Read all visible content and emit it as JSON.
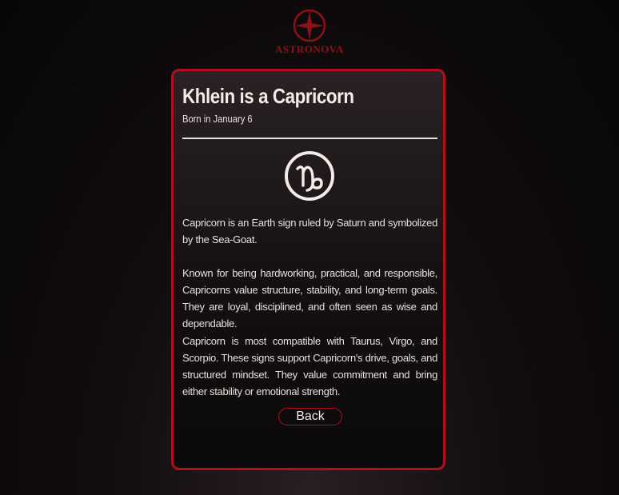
{
  "brand": {
    "name": "ASTRONOVA",
    "logo_icon": "compass-star-icon",
    "color": "#8e1018"
  },
  "card": {
    "title": "Khlein is a Capricorn",
    "subtitle": "Born in January 6",
    "symbol_icon": "capricorn-icon",
    "paragraphs": [
      "Capricorn is an Earth sign ruled by Saturn and symbolized by the Sea-Goat.",
      "Known for being hardworking, practical, and responsible, Capricorns value structure, stability, and long-term goals. They are loyal, disciplined, and often seen as wise and dependable.",
      "Capricorn is most compatible with Taurus, Virgo, and Scorpio. These signs support Capricorn's drive, goals, and structured mindset. They value commitment and bring either stability or emotional strength."
    ],
    "back_label": "Back",
    "accent_color": "#b0101c"
  }
}
